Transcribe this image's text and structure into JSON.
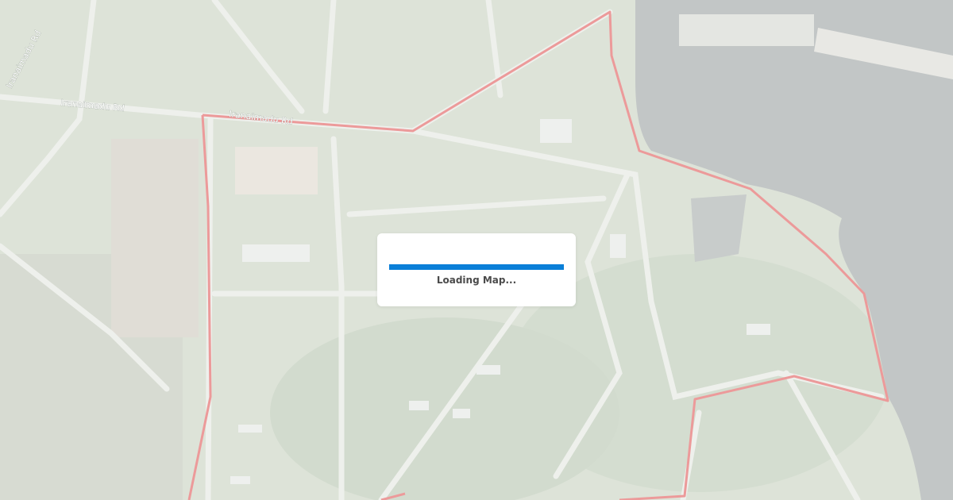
{
  "map": {
    "road_labels": [
      "Iranaimadu Rd",
      "Iranaimadu Rd",
      "Iranaimadu Rd"
    ],
    "boundary_color": "#ec9a9a",
    "road_color": "#f1f2ee",
    "water_color": "#b9bcbd",
    "vegetation_color": "#cfd8ca"
  },
  "loader": {
    "text": "Loading Map...",
    "progress_percent": 100,
    "bar_color": "#0a7fd8"
  }
}
